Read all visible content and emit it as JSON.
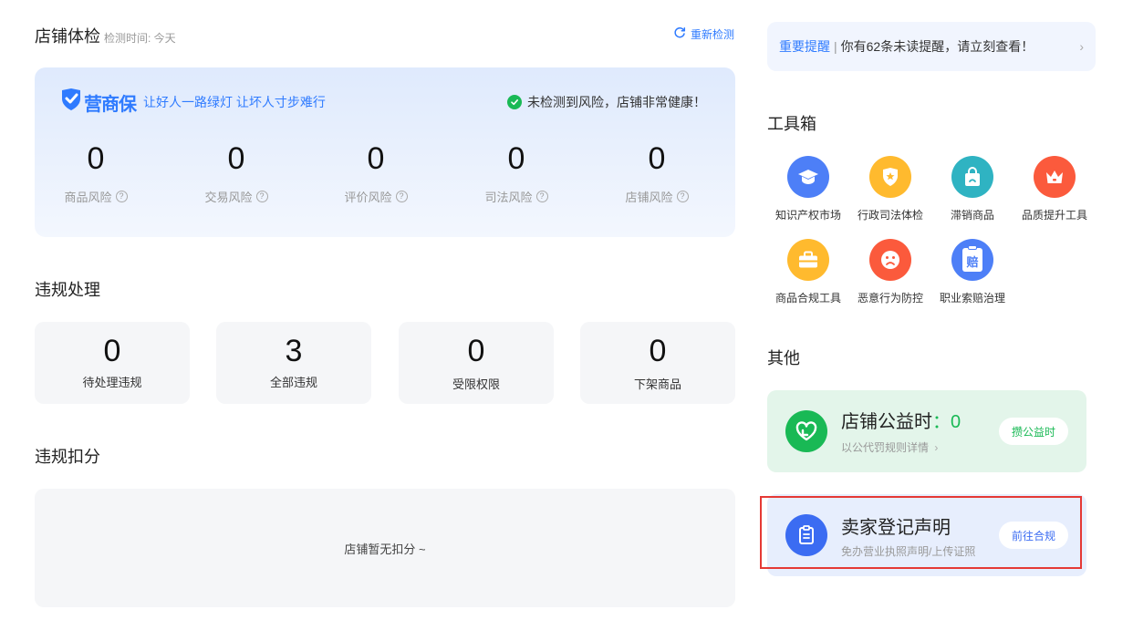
{
  "health": {
    "title": "店铺体检",
    "check_time": "检测时间: 今天",
    "recheck": "重新检测",
    "brand_name": "营商保",
    "brand_slogan": "让好人一路绿灯 让坏人寸步难行",
    "status": "未检测到风险，店铺非常健康！",
    "risks": [
      {
        "value": "0",
        "label": "商品风险"
      },
      {
        "value": "0",
        "label": "交易风险"
      },
      {
        "value": "0",
        "label": "评价风险"
      },
      {
        "value": "0",
        "label": "司法风险"
      },
      {
        "value": "0",
        "label": "店铺风险"
      }
    ]
  },
  "violations": {
    "title": "违规处理",
    "cards": [
      {
        "value": "0",
        "label": "待处理违规"
      },
      {
        "value": "3",
        "label": "全部违规"
      },
      {
        "value": "0",
        "label": "受限权限"
      },
      {
        "value": "0",
        "label": "下架商品"
      }
    ]
  },
  "deduction": {
    "title": "违规扣分",
    "empty_text": "店铺暂无扣分 ~"
  },
  "notice": {
    "tag": "重要提醒",
    "separator": "|",
    "text": "你有62条未读提醒，请立刻查看！",
    "chevron": "›"
  },
  "toolbox": {
    "title": "工具箱",
    "tools": [
      {
        "label": "知识产权市场",
        "icon": "graduation-cap-icon",
        "color": "#4d7ff7"
      },
      {
        "label": "行政司法体检",
        "icon": "shield-star-icon",
        "color": "#ffba2e"
      },
      {
        "label": "滞销商品",
        "icon": "shopping-bag-icon",
        "color": "#2fb3c2"
      },
      {
        "label": "品质提升工具",
        "icon": "crown-icon",
        "color": "#fb5a3c"
      },
      {
        "label": "商品合规工具",
        "icon": "briefcase-icon",
        "color": "#ffba2e"
      },
      {
        "label": "恶意行为防控",
        "icon": "sad-face-icon",
        "color": "#fb5a3c"
      },
      {
        "label": "职业索赔治理",
        "icon": "compensation-icon",
        "color": "#4d7ff7",
        "glyph": "赔"
      }
    ]
  },
  "others": {
    "title": "其他",
    "public_welfare": {
      "title": "店铺公益时",
      "colon": "：",
      "value": "0",
      "sub": "以公代罚规则详情",
      "chevron": "›",
      "button": "攒公益时",
      "bg": "#e3f5ea",
      "accent": "#19b955"
    },
    "seller_statement": {
      "title": "卖家登记声明",
      "sub": "免办营业执照声明/上传证照",
      "button": "前往合规",
      "bg": "#e7eefd",
      "accent": "#3b6cf2"
    }
  }
}
